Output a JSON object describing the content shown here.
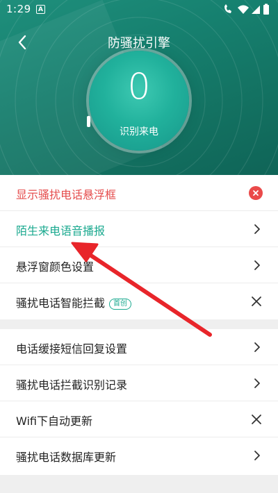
{
  "status_bar": {
    "time": "1:29",
    "notification_badge": "A"
  },
  "header": {
    "title": "防骚扰引擎",
    "back_icon": "chevron-left-icon"
  },
  "dial": {
    "count": "0",
    "label": "识别来电"
  },
  "settings_group_1": [
    {
      "label": "显示骚扰电话悬浮框",
      "control": "close-circle",
      "color": "#e54c4c"
    },
    {
      "label": "陌生来电语音播报",
      "control": "chevron",
      "color": "#1aa98f"
    },
    {
      "label": "悬浮窗颜色设置",
      "control": "chevron"
    },
    {
      "label": "骚扰电话智能拦截",
      "badge": "首创",
      "control": "x"
    }
  ],
  "settings_group_2": [
    {
      "label": "电话缓接短信回复设置",
      "control": "chevron"
    },
    {
      "label": "骚扰电话拦截识别记录",
      "control": "chevron"
    },
    {
      "label": "Wifi下自动更新",
      "control": "x"
    },
    {
      "label": "骚扰电话数据库更新",
      "control": "chevron"
    }
  ],
  "colors": {
    "accent_green": "#1aa98f",
    "alert_red": "#e54c4c",
    "header_teal": "#16806f",
    "annotation_arrow": "#e8252a"
  }
}
